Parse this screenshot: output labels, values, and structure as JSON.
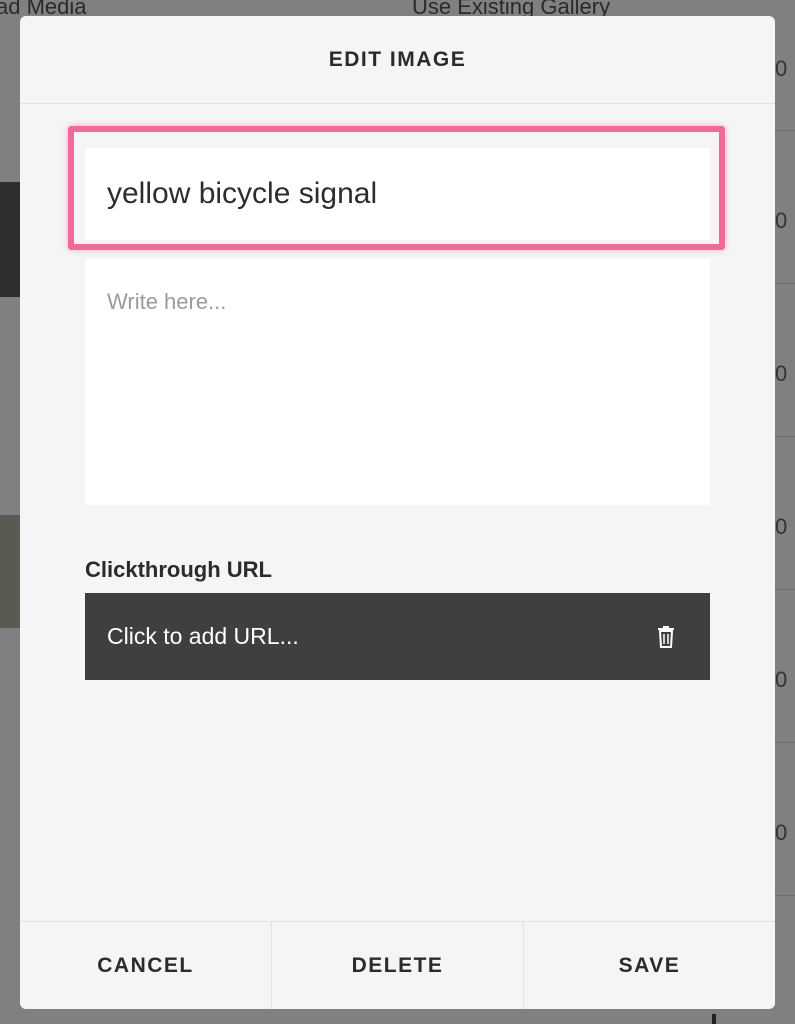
{
  "background": {
    "tabs": [
      "ad Media",
      "Use Existing Gallery"
    ],
    "right_column_digits": [
      "0",
      "0",
      "0",
      "0",
      "0",
      "0",
      "0"
    ]
  },
  "modal": {
    "title": "EDIT IMAGE",
    "image_title_value": "yellow bicycle signal",
    "description_placeholder": "Write here...",
    "clickthrough_label": "Clickthrough URL",
    "clickthrough_placeholder": "Click to add URL...",
    "trash_icon": "trash-icon",
    "footer": {
      "cancel_label": "CANCEL",
      "delete_label": "DELETE",
      "save_label": "SAVE"
    }
  },
  "colors": {
    "highlight": "#ee6a9b",
    "url_bar": "#3f3f3f",
    "modal_bg": "#f5f5f5"
  }
}
